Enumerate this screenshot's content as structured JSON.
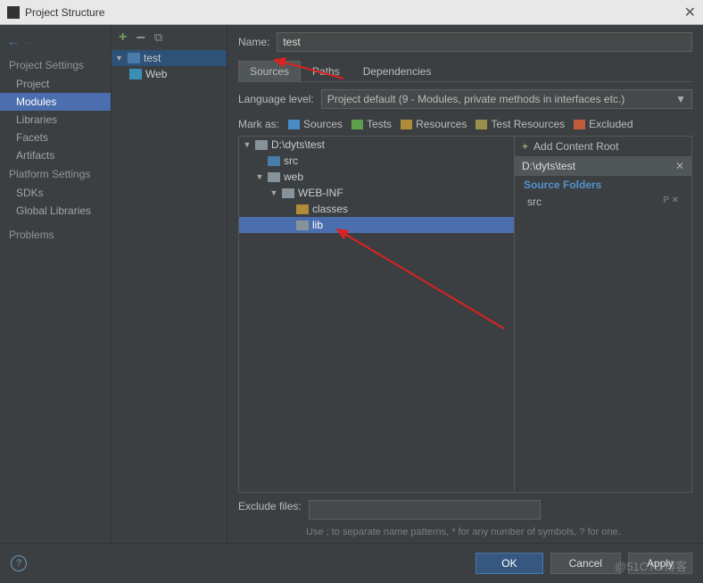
{
  "title": "Project Structure",
  "left": {
    "section1": "Project Settings",
    "items1": [
      "Project",
      "Modules",
      "Libraries",
      "Facets",
      "Artifacts"
    ],
    "section2": "Platform Settings",
    "items2": [
      "SDKs",
      "Global Libraries"
    ],
    "section3": "Problems",
    "selected": "Modules"
  },
  "mid": {
    "module": "test",
    "facet": "Web"
  },
  "right": {
    "name_label": "Name:",
    "name_value": "test",
    "tabs": [
      "Sources",
      "Paths",
      "Dependencies"
    ],
    "active_tab": "Sources",
    "lang_label": "Language level:",
    "lang_value": "Project default (9 - Modules, private methods in interfaces etc.)",
    "markas_label": "Mark as:",
    "marks": [
      "Sources",
      "Tests",
      "Resources",
      "Test Resources",
      "Excluded"
    ],
    "tree": {
      "root": "D:\\dyts\\test",
      "items": [
        "src",
        "web",
        "WEB-INF",
        "classes",
        "lib"
      ],
      "selected": "lib"
    },
    "roots": {
      "add": "Add Content Root",
      "path": "D:\\dyts\\test",
      "source_header": "Source Folders",
      "src": "src"
    },
    "exclude_label": "Exclude files:",
    "exclude_value": "",
    "exclude_hint": "Use ; to separate name patterns, * for any number of symbols, ? for one."
  },
  "footer": {
    "ok": "OK",
    "cancel": "Cancel",
    "apply": "Apply"
  },
  "watermark": "@51CTO博客"
}
